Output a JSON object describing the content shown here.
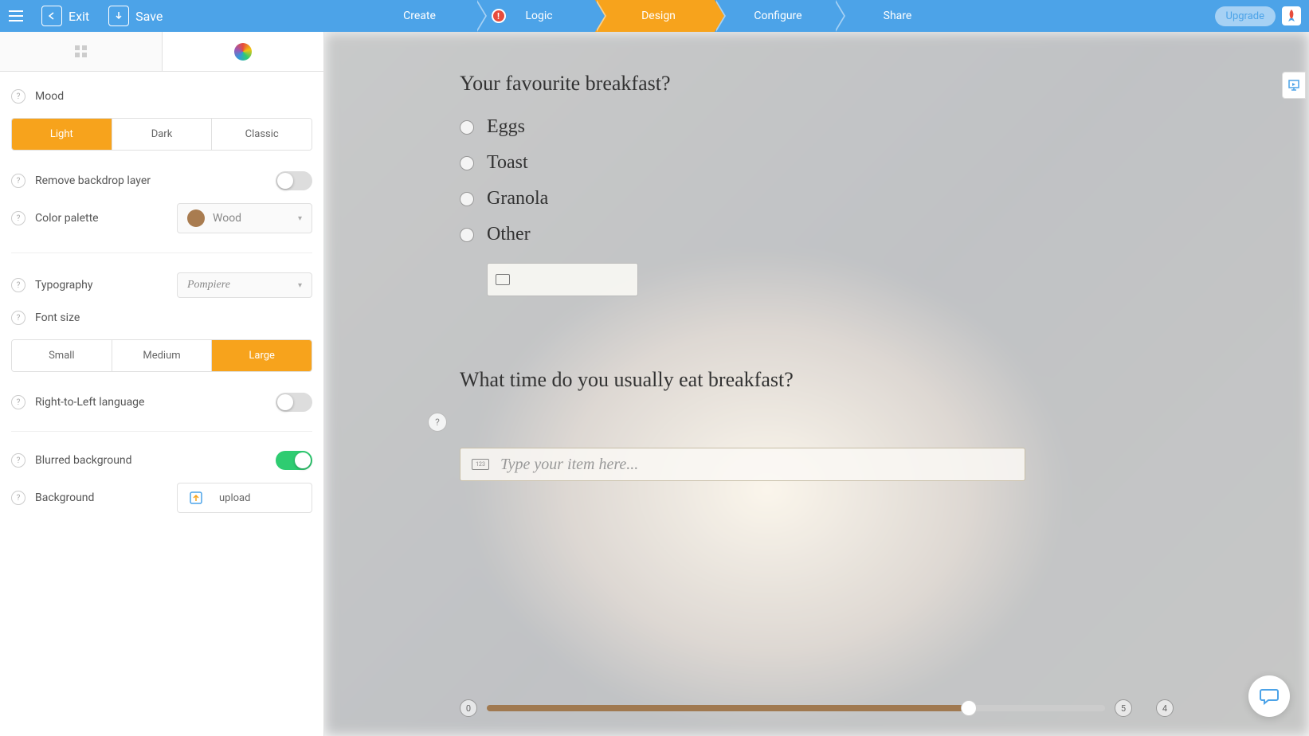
{
  "header": {
    "exit": "Exit",
    "save": "Save",
    "upgrade": "Upgrade",
    "steps": [
      "Create",
      "Logic",
      "Design",
      "Configure",
      "Share"
    ],
    "active_step": "Design"
  },
  "sidebar": {
    "mood": {
      "label": "Mood",
      "options": [
        "Light",
        "Dark",
        "Classic"
      ],
      "selected": "Light"
    },
    "remove_backdrop": {
      "label": "Remove backdrop layer",
      "value": false
    },
    "color_palette": {
      "label": "Color palette",
      "selected": "Wood",
      "swatch": "#a97c50"
    },
    "typography": {
      "label": "Typography",
      "selected": "Pompiere"
    },
    "font_size": {
      "label": "Font size",
      "options": [
        "Small",
        "Medium",
        "Large"
      ],
      "selected": "Large"
    },
    "rtl": {
      "label": "Right-to-Left language",
      "value": false
    },
    "blurred_bg": {
      "label": "Blurred background",
      "value": true
    },
    "background": {
      "label": "Background",
      "action": "upload"
    }
  },
  "preview": {
    "q1": {
      "title": "Your favourite breakfast?",
      "options": [
        "Eggs",
        "Toast",
        "Granola",
        "Other"
      ]
    },
    "q2": {
      "title": "What time do you usually eat breakfast?",
      "placeholder": "Type your item here..."
    },
    "progress": {
      "start": "0",
      "end": "5",
      "total": "4",
      "fill_pct": 78
    }
  },
  "colors": {
    "accent": "#f7a31c",
    "topbar": "#4ca3e8",
    "wood": "#a07950"
  }
}
